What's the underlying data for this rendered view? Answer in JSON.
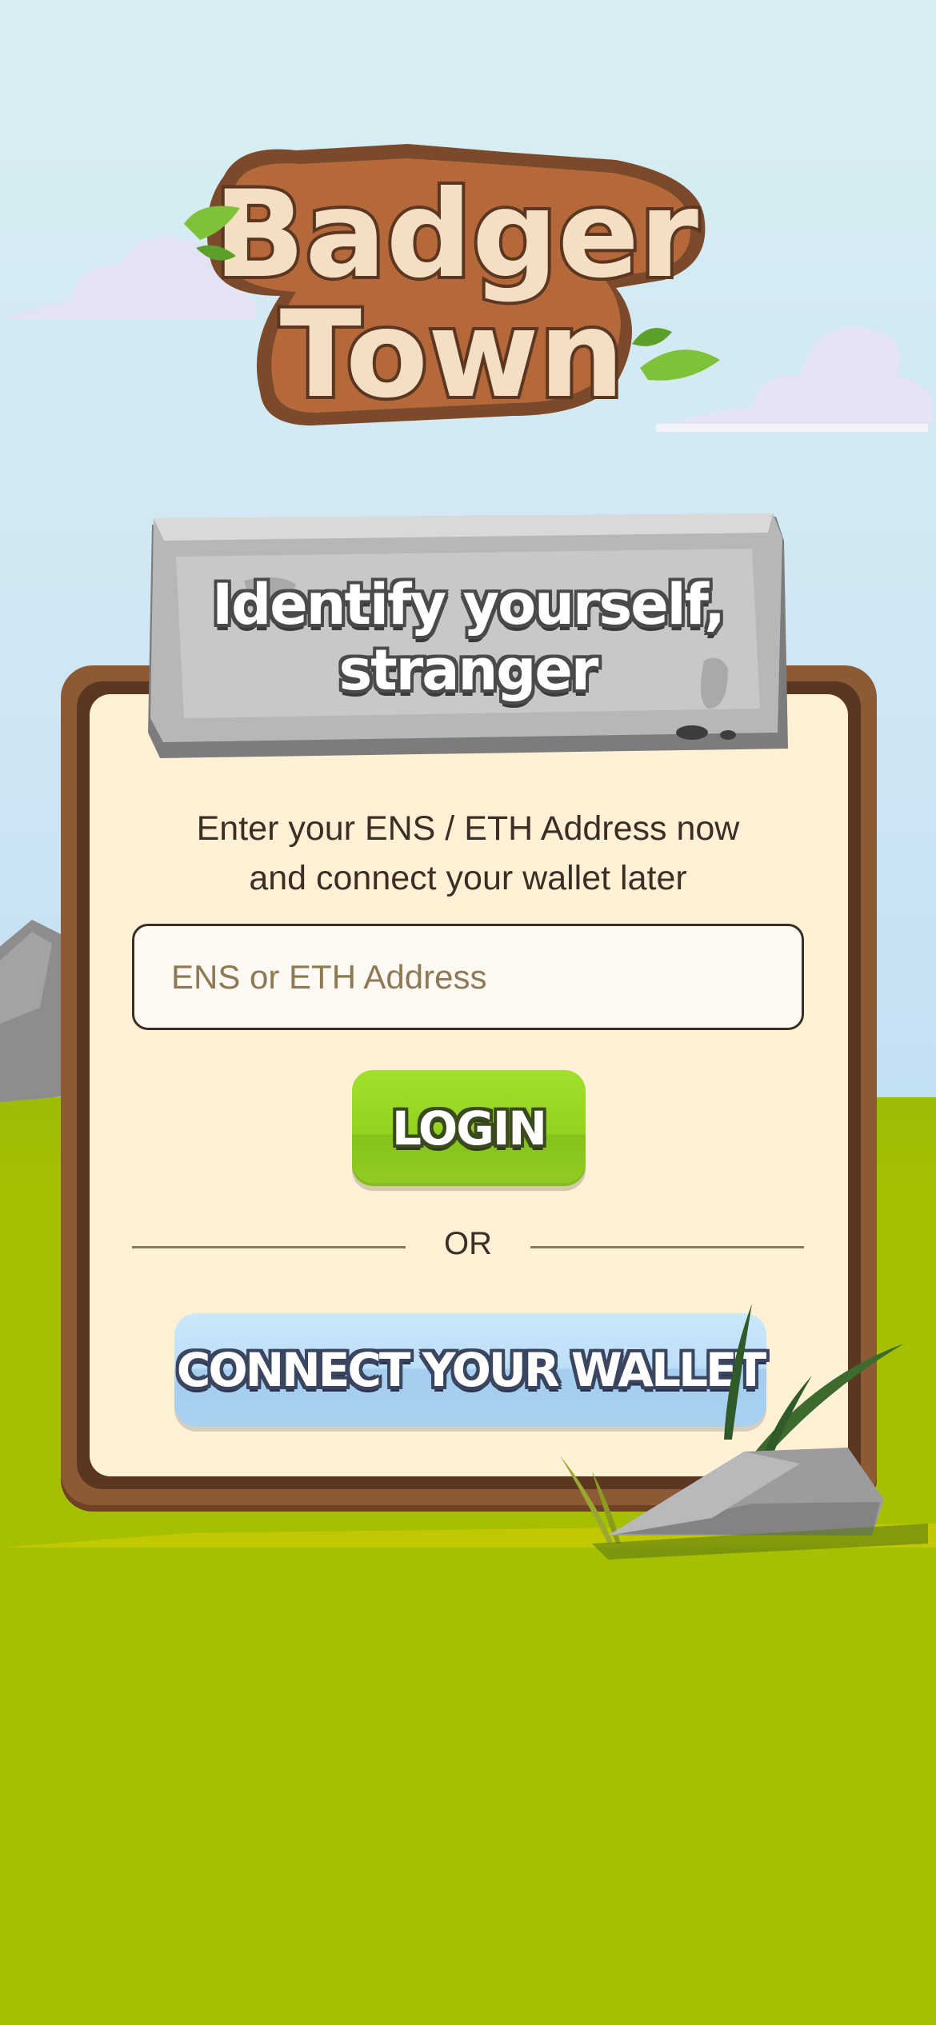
{
  "app": {
    "logo_text_line1": "Badger",
    "logo_text_line2": "Town"
  },
  "sign": {
    "title_line1": "Identify yourself,",
    "title_line2": "stranger"
  },
  "login": {
    "subtitle_line1": "Enter your ENS / ETH Address now",
    "subtitle_line2": "and connect your wallet later",
    "address_placeholder": "ENS or ETH Address",
    "address_value": "",
    "login_label": "LOGIN",
    "or_label": "OR",
    "connect_wallet_label": "CONNECT YOUR WALLET"
  },
  "icons": {
    "logo": "badger-town-logo",
    "clouds": "cloud-icon",
    "rocks": "rock-icon",
    "grass": "grass-icon"
  },
  "colors": {
    "login_button": "#94d222",
    "wallet_button": "#bddff8",
    "board_frame": "#8c5a35",
    "board_panel": "#fff1d6",
    "ground": "#a6c001",
    "sky": "#cfe6f3"
  }
}
